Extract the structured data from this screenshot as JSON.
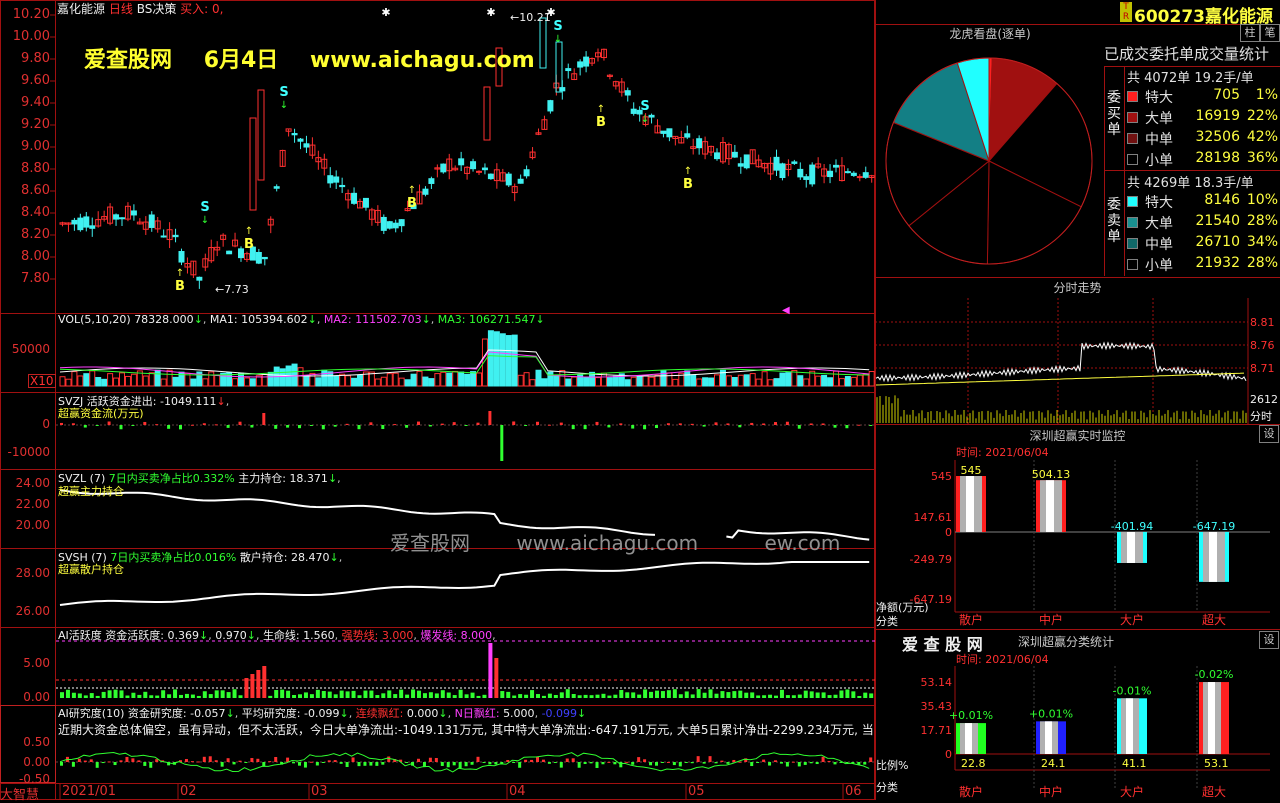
{
  "header": {
    "stock_name": "嘉化能源",
    "period": "日线",
    "indicator": "BS决策",
    "buy_signal_label": "买入: 0,"
  },
  "watermark": {
    "site": "爱查股网",
    "date": "6月4日",
    "url": "www.aichagu.com",
    "center_site": "爱查股网",
    "center_url": "www.aichagu.com",
    "center_tail": "ew.com"
  },
  "price_chart": {
    "y_ticks": [
      "10.20",
      "10.00",
      "9.80",
      "9.60",
      "9.40",
      "9.20",
      "9.00",
      "8.80",
      "8.60",
      "8.40",
      "8.20",
      "8.00",
      "7.80"
    ],
    "high_label": "10.21",
    "low_label": "7.73",
    "signals": [
      {
        "type": "B",
        "x": 180,
        "y": 290
      },
      {
        "type": "S",
        "x": 205,
        "y": 211
      },
      {
        "type": "B",
        "x": 249,
        "y": 248
      },
      {
        "type": "S",
        "x": 284,
        "y": 96
      },
      {
        "type": "B",
        "x": 412,
        "y": 207
      },
      {
        "type": "S",
        "x": 558,
        "y": 30
      },
      {
        "type": "B",
        "x": 601,
        "y": 126
      },
      {
        "type": "S",
        "x": 645,
        "y": 110
      },
      {
        "type": "B",
        "x": 688,
        "y": 188
      }
    ]
  },
  "vol_panel": {
    "title": "VOL(5,10,20)",
    "vol": "78328.000",
    "ma1_label": "MA1:",
    "ma1": "105394.602",
    "ma2_label": "MA2:",
    "ma2": "111502.703",
    "ma3_label": "MA3:",
    "ma3": "106271.547",
    "y_tick": "50000",
    "unit": "X10"
  },
  "svzj_panel": {
    "name": "SVZJ",
    "label": "活跃资金进出:",
    "value": "-1049.111",
    "sublabel": "超赢资金流(万元)",
    "y_ticks": [
      "0",
      "-10000"
    ]
  },
  "svzl_panel": {
    "name": "SVZL",
    "param": "(7)",
    "label": "7日内买卖净占比",
    "ratio": "0.332%",
    "hold_label": "主力持仓:",
    "hold": "18.371",
    "sublabel": "超赢主力持仓",
    "y_ticks": [
      "24.00",
      "22.00",
      "20.00"
    ]
  },
  "svsh_panel": {
    "name": "SVSH",
    "param": "(7)",
    "label": "7日内买卖净占比",
    "ratio": "0.016%",
    "hold_label": "散户持仓:",
    "hold": "28.470",
    "sublabel": "超赢散户持仓",
    "y_ticks": [
      "28.00",
      "26.00"
    ]
  },
  "ai_active_panel": {
    "name": "AI活跃度",
    "label1": "资金活跃度:",
    "v1": "0.369",
    "v2": "0.970",
    "life_label": "生命线:",
    "life": "1.560",
    "strong_label": "强势线:",
    "strong": "3.000",
    "burst_label": "爆发线:",
    "burst": "8.000",
    "y_ticks": [
      "5.00",
      "0.00"
    ]
  },
  "ai_research_panel": {
    "name": "AI研究度",
    "param": "(10)",
    "label1": "资金研究度:",
    "v1": "-0.057",
    "label2": "平均研究度:",
    "v2": "-0.099",
    "label3": "连续飘红:",
    "v3": "0.000",
    "label4": "N日飘红:",
    "v4": "5.000",
    "v5": "-0.099",
    "summary": "近期大资金总体偏空，虽有异动，但不太活跃，今日大单净流出:-1049.131万元, 其中特大单净流出:-647.191万元, 大单5日累计净出-2299.234万元, 当",
    "y_ticks": [
      "0.50",
      "0.00",
      "-0.50"
    ]
  },
  "bottom": {
    "logo": "大智慧",
    "dates": [
      "2021/01",
      "02",
      "03",
      "04",
      "05",
      "06"
    ]
  },
  "right_header": {
    "code": "600273",
    "name": "嘉化能源",
    "badge_top": "T",
    "badge_bot": "R",
    "btn1": "柱",
    "btn2": "笔"
  },
  "dragon_panel": {
    "title": "龙虎看盘(逐单)",
    "stats_title": "已成交委托单成交量统计",
    "buy_side_label": "委买单",
    "buy_total": "共 4072单 19.2手/单",
    "sell_side_label": "委卖单",
    "sell_total": "共 4269单 18.3手/单",
    "buy_rows": [
      {
        "label": "特大",
        "count": "705",
        "pct": "1%",
        "color": "#ff2020"
      },
      {
        "label": "大单",
        "count": "16919",
        "pct": "22%",
        "color": "#a01010"
      },
      {
        "label": "中单",
        "count": "32506",
        "pct": "42%",
        "color": "#701010"
      },
      {
        "label": "小单",
        "count": "28198",
        "pct": "36%",
        "color": "#000000"
      }
    ],
    "sell_rows": [
      {
        "label": "特大",
        "count": "8146",
        "pct": "10%",
        "color": "#20ffff"
      },
      {
        "label": "大单",
        "count": "21540",
        "pct": "28%",
        "color": "#1a9090"
      },
      {
        "label": "中单",
        "count": "26710",
        "pct": "34%",
        "color": "#106868"
      },
      {
        "label": "小单",
        "count": "21932",
        "pct": "28%",
        "color": "#000000"
      }
    ],
    "pie_slices": [
      {
        "value": 1,
        "color": "#ff2020"
      },
      {
        "value": 22,
        "color": "#a01010"
      },
      {
        "value": 42,
        "color": "#000000"
      },
      {
        "value": 36,
        "color": "#000000"
      },
      {
        "value": 28,
        "color": "#000000"
      },
      {
        "value": 34,
        "color": "#000000"
      },
      {
        "value": 28,
        "color": "#137f85"
      },
      {
        "value": 10,
        "color": "#20ffff"
      }
    ]
  },
  "intraday_panel": {
    "title": "分时走势",
    "y_ticks": [
      "8.81",
      "8.76",
      "8.71"
    ],
    "vol_label": "2612",
    "time_label": "分时"
  },
  "monitor_panel": {
    "title": "深圳超赢实时监控",
    "btn": "设",
    "time": "时间: 2021/06/04",
    "y_ticks": [
      "545",
      "147.61",
      "0",
      "-249.79",
      "-647.19"
    ],
    "y_unit": "净额(万元)",
    "cat_label": "分类",
    "bars": [
      {
        "name": "散户",
        "value": 545,
        "label": "545"
      },
      {
        "name": "中户",
        "value": 504.13,
        "label": "504.13"
      },
      {
        "name": "大户",
        "value": -401.94,
        "label": "-401.94"
      },
      {
        "name": "超大",
        "value": -647.19,
        "label": "-647.19"
      }
    ]
  },
  "class_panel": {
    "logo": "爱 查 股 网",
    "title": "深圳超赢分类统计",
    "btn": "设",
    "time": "时间: 2021/06/04",
    "y_ticks": [
      "53.14",
      "35.43",
      "17.71",
      "0"
    ],
    "y_unit": "比例%",
    "cat_label": "分类",
    "bars": [
      {
        "name": "散户",
        "value": 22.8,
        "label": "22.8",
        "delta": "+0.01%",
        "color": "#20ff20"
      },
      {
        "name": "中户",
        "value": 24.1,
        "label": "24.1",
        "delta": "+0.01%",
        "color": "#2020ff"
      },
      {
        "name": "大户",
        "value": 41.1,
        "label": "41.1",
        "delta": "-0.01%",
        "color": "#20ffff"
      },
      {
        "name": "超大",
        "value": 53.1,
        "label": "53.1",
        "delta": "-0.02%",
        "color": "#ff2020"
      }
    ]
  }
}
